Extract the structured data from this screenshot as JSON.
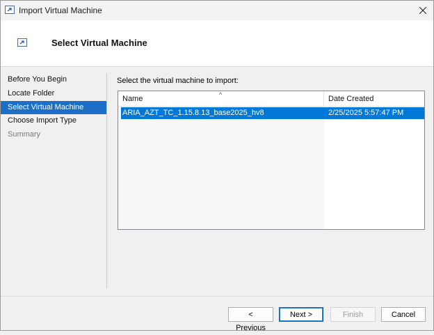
{
  "window": {
    "title": "Import Virtual Machine"
  },
  "header": {
    "title": "Select Virtual Machine"
  },
  "nav": {
    "items": [
      {
        "label": "Before You Begin",
        "state": "normal"
      },
      {
        "label": "Locate Folder",
        "state": "normal"
      },
      {
        "label": "Select Virtual Machine",
        "state": "active"
      },
      {
        "label": "Choose Import Type",
        "state": "normal"
      },
      {
        "label": "Summary",
        "state": "disabled"
      }
    ]
  },
  "main": {
    "prompt": "Select the virtual machine to import:",
    "columns": [
      "Name",
      "Date Created"
    ],
    "sort_column": "Name",
    "rows": [
      {
        "name": "ARIA_AZT_TC_1.15.8.13_base2025_hv8",
        "date_created": "2/25/2025 5:57:47 PM",
        "selected": true
      }
    ]
  },
  "buttons": {
    "previous": "< Previous",
    "next": "Next >",
    "finish": "Finish",
    "cancel": "Cancel"
  },
  "colors": {
    "selection": "#0078d7",
    "nav_active": "#1c6fc4",
    "window_bg": "#f0f0f0"
  },
  "icons": {
    "title": "vm-import-icon",
    "close": "close-icon",
    "sort": "sort-ascending-icon"
  }
}
